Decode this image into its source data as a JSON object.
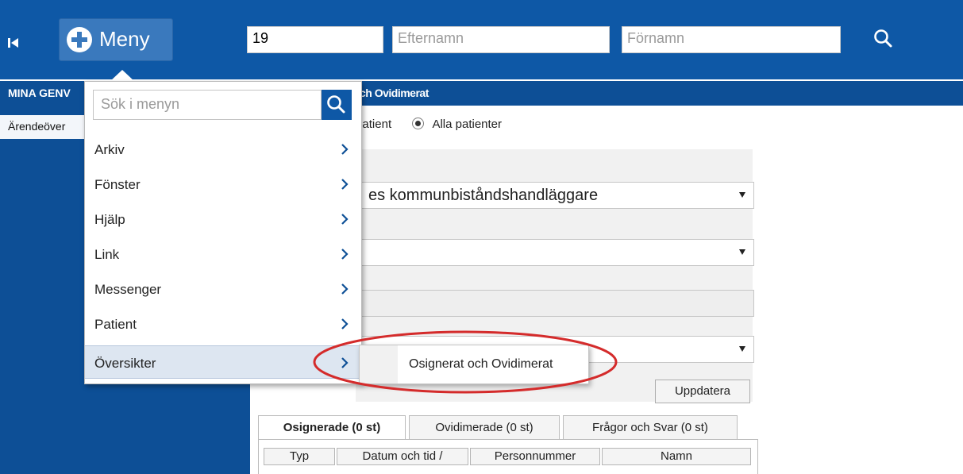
{
  "topbar": {
    "menu_label": "Meny",
    "personnummer_value": "19",
    "lastname_placeholder": "Efternamn",
    "firstname_placeholder": "Förnamn"
  },
  "subbar": {
    "left_text": "MINA GENV",
    "right_text": "ch Ovidimerat"
  },
  "sidebar": {
    "item_label": "Ärendeöver"
  },
  "filters": {
    "radio_vald": "Vald patient",
    "radio_alla": "Alla patienter",
    "radio_selected": "Alla patienter",
    "role_select_text": "es kommunbiståndshandläggare",
    "update_label": "Uppdatera"
  },
  "tabs": [
    {
      "label": "Osignerade  (0 st)",
      "active": true
    },
    {
      "label": "Ovidimerade  (0 st)",
      "active": false
    },
    {
      "label": "Frågor och Svar  (0 st)",
      "active": false
    }
  ],
  "table": {
    "columns": [
      "Typ",
      "Datum och tid /",
      "Personnummer",
      "Namn"
    ]
  },
  "menu": {
    "search_placeholder": "Sök i menyn",
    "items": [
      {
        "label": "Arkiv"
      },
      {
        "label": "Fönster"
      },
      {
        "label": "Hjälp"
      },
      {
        "label": "Link"
      },
      {
        "label": "Messenger"
      },
      {
        "label": "Patient"
      },
      {
        "label": "Översikter"
      }
    ],
    "highlighted": "Översikter"
  },
  "submenu": {
    "item_label": "Osignerat och Ovidimerat"
  },
  "colors": {
    "topbar": "#0e58a6",
    "subbar": "#0d4f96",
    "highlight_ring": "#d42b2b"
  }
}
